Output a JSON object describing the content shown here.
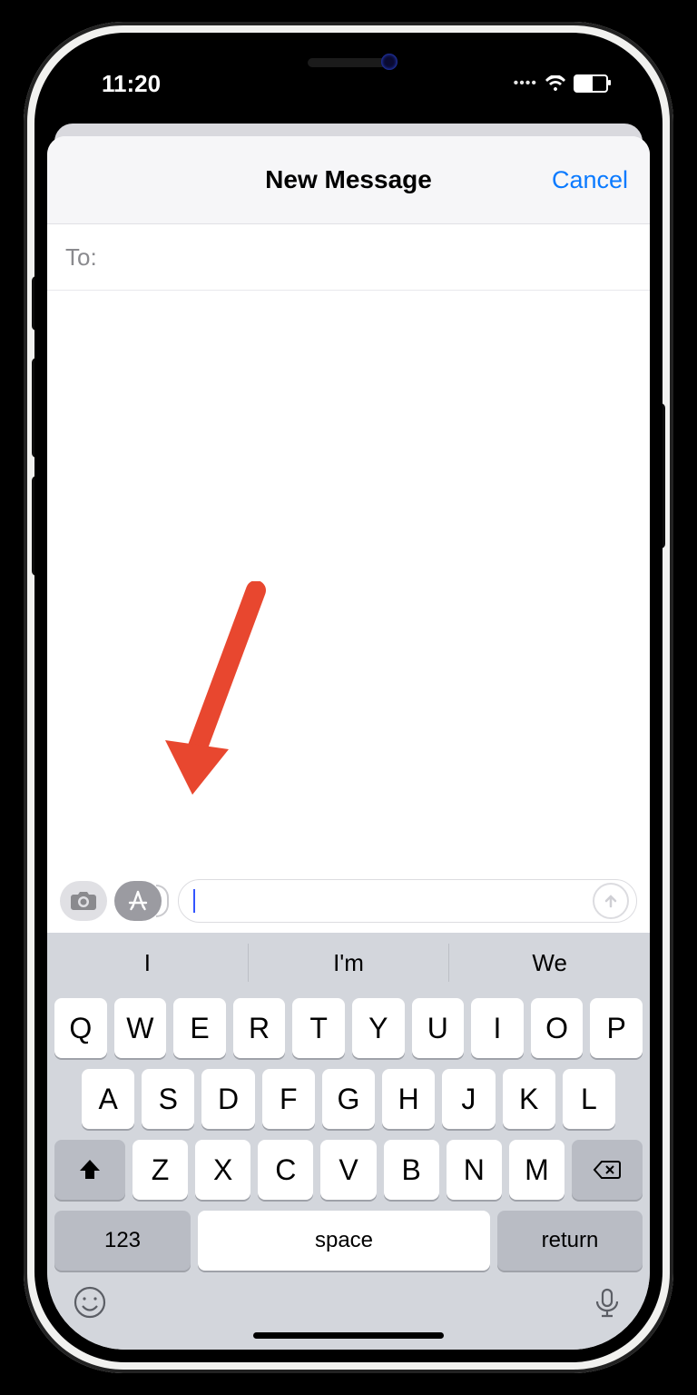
{
  "status": {
    "time": "11:20"
  },
  "nav": {
    "title": "New Message",
    "cancel": "Cancel"
  },
  "to": {
    "label": "To:"
  },
  "compose": {
    "message_value": ""
  },
  "predictive": [
    "I",
    "I'm",
    "We"
  ],
  "keyboard": {
    "row1": [
      "Q",
      "W",
      "E",
      "R",
      "T",
      "Y",
      "U",
      "I",
      "O",
      "P"
    ],
    "row2": [
      "A",
      "S",
      "D",
      "F",
      "G",
      "H",
      "J",
      "K",
      "L"
    ],
    "row3": [
      "Z",
      "X",
      "C",
      "V",
      "B",
      "N",
      "M"
    ],
    "numeric_label": "123",
    "space_label": "space",
    "return_label": "return"
  }
}
